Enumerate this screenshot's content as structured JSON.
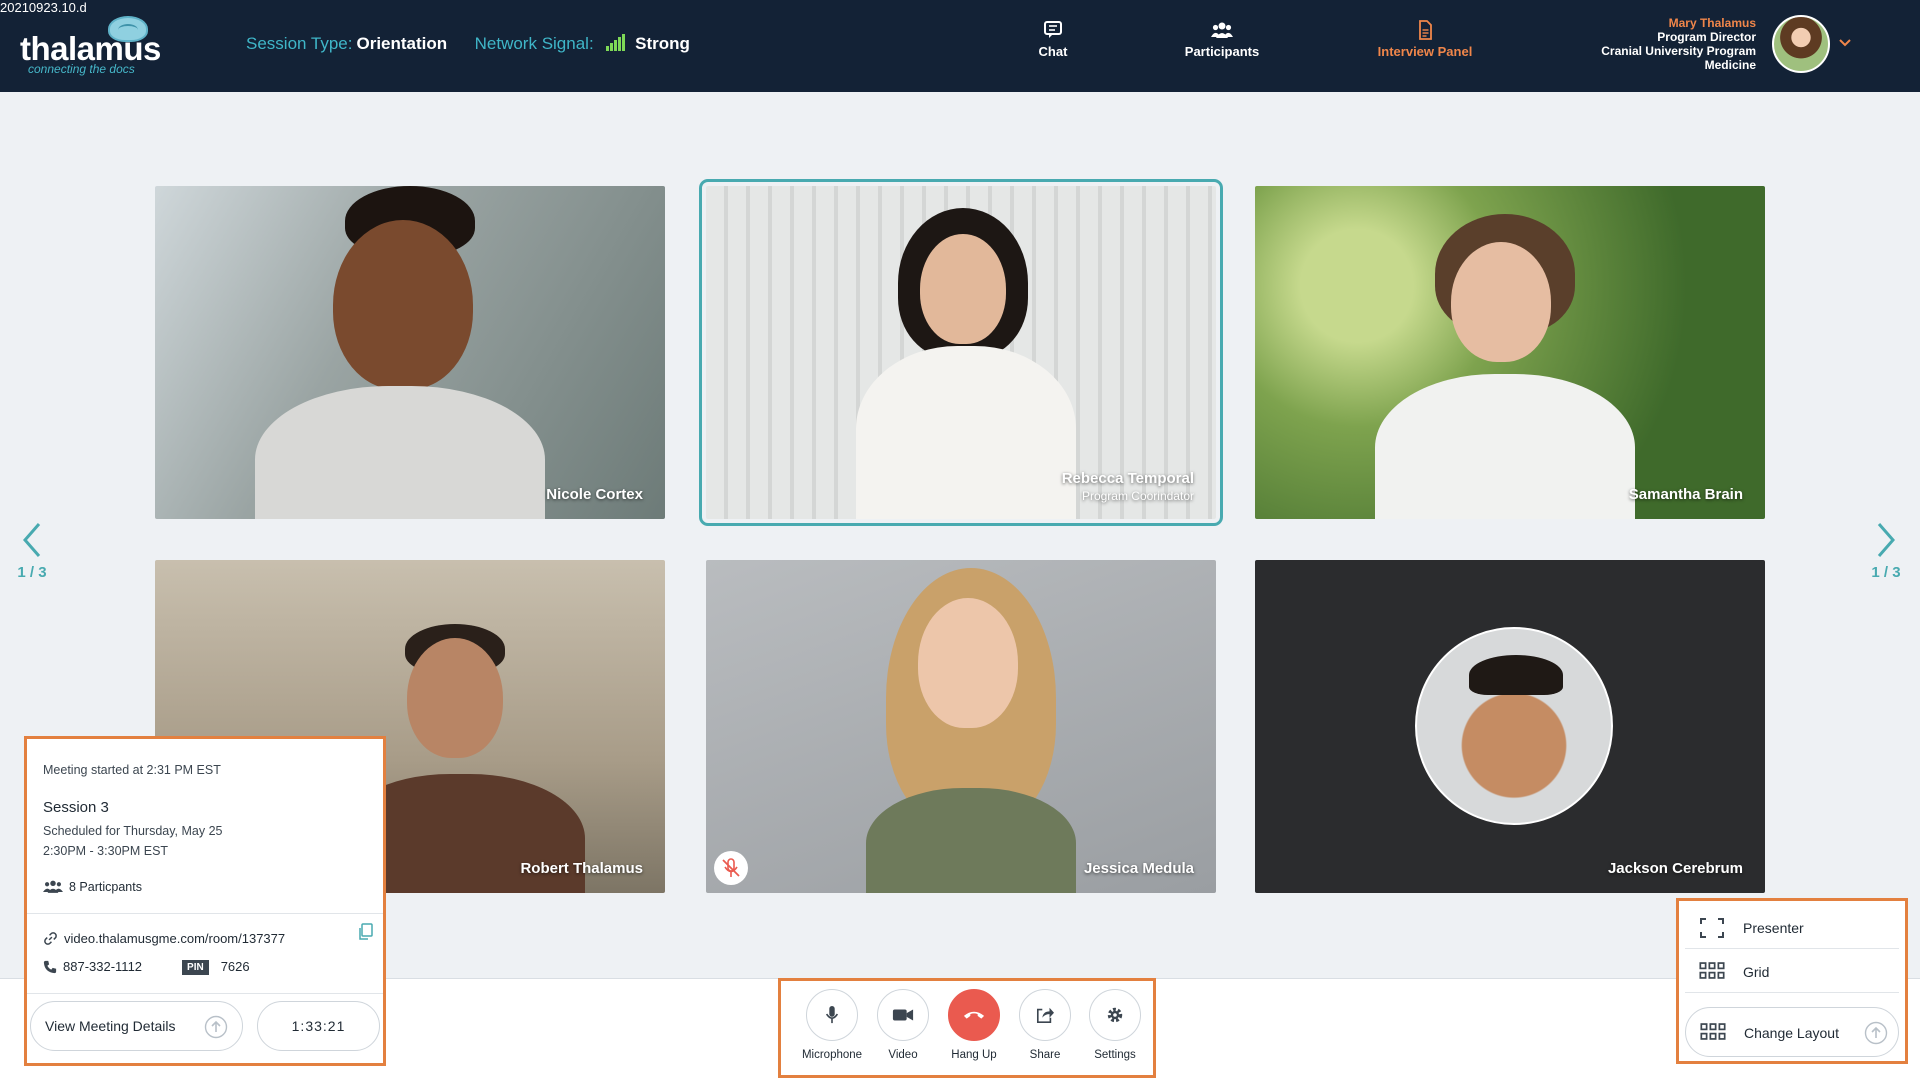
{
  "build_tag": "20210923.10.d",
  "logo": {
    "wordmark": "thalamus",
    "tagline": "connecting the docs"
  },
  "session": {
    "type_label": "Session Type:",
    "type_value": "Orientation",
    "signal_label": "Network Signal:",
    "signal_value": "Strong",
    "signal_color": "#7ed957"
  },
  "nav": [
    {
      "label": "Chat",
      "icon": "chat-icon"
    },
    {
      "label": "Participants",
      "icon": "participants-icon"
    },
    {
      "label": "Interview Panel",
      "icon": "document-icon",
      "active": true
    }
  ],
  "user": {
    "name": "Mary Thalamus",
    "title": "Program Director",
    "org": "Cranial University Program",
    "dept": "Medicine"
  },
  "participants": [
    {
      "name": "Nicole Cortex"
    },
    {
      "name": "Rebecca Temporal",
      "role": "Program Coorindator",
      "selected": true
    },
    {
      "name": "Samantha Brain"
    },
    {
      "name": "Robert Thalamus"
    },
    {
      "name": "Jessica Medula",
      "muted": true
    },
    {
      "name": "Jackson Cerebrum",
      "video_off": true
    }
  ],
  "pager": {
    "left": "1 / 3",
    "right": "1 / 3"
  },
  "meeting": {
    "started": "Meeting started at 2:31 PM EST",
    "title": "Session 3",
    "scheduled": "Scheduled for Thursday, May 25",
    "time_range": "2:30PM - 3:30PM EST",
    "participants": "8 Particpants",
    "link": "video.thalamusgme.com/room/137377",
    "phone": "887-332-1112",
    "pin_label": "PIN",
    "pin": "7626",
    "details_button": "View Meeting Details",
    "timer": "1:33:21"
  },
  "controls": [
    {
      "label": "Microphone",
      "icon": "microphone-icon"
    },
    {
      "label": "Video",
      "icon": "video-camera-icon"
    },
    {
      "label": "Hang Up",
      "icon": "hang-up-icon"
    },
    {
      "label": "Share",
      "icon": "share-icon"
    },
    {
      "label": "Settings",
      "icon": "gear-icon"
    }
  ],
  "layout": {
    "options": [
      {
        "label": "Presenter",
        "icon": "presenter-icon"
      },
      {
        "label": "Grid",
        "icon": "grid-icon"
      }
    ],
    "change_label": "Change Layout"
  },
  "colors": {
    "accent": "#48aab0",
    "highlight": "#e3803f",
    "header_bg": "#132236",
    "hangup": "#ea5a4f"
  }
}
